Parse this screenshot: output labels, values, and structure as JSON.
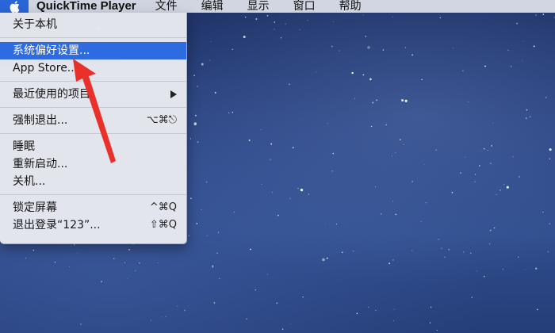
{
  "menubar": {
    "app_name": "QuickTime Player",
    "items": [
      "文件",
      "编辑",
      "显示",
      "窗口",
      "帮助"
    ]
  },
  "apple_menu": {
    "groups": [
      [
        {
          "label": "关于本机",
          "shortcut": ""
        }
      ],
      [
        {
          "label": "系统偏好设置...",
          "shortcut": "",
          "selected": true
        },
        {
          "label": "App Store...",
          "shortcut": ""
        }
      ],
      [
        {
          "label": "最近使用的项目",
          "shortcut": "",
          "submenu": true
        }
      ],
      [
        {
          "label": "强制退出...",
          "shortcut": "⌥⌘⎋"
        }
      ],
      [
        {
          "label": "睡眠",
          "shortcut": ""
        },
        {
          "label": "重新启动...",
          "shortcut": ""
        },
        {
          "label": "关机...",
          "shortcut": ""
        }
      ],
      [
        {
          "label": "锁定屏幕",
          "shortcut": "^⌘Q"
        },
        {
          "label": "退出登录“123”...",
          "shortcut": "⇧⌘Q"
        }
      ]
    ]
  },
  "colors": {
    "highlight": "#2f6be0",
    "arrow": "#e8312a",
    "apple_button": "#2a65d8"
  }
}
